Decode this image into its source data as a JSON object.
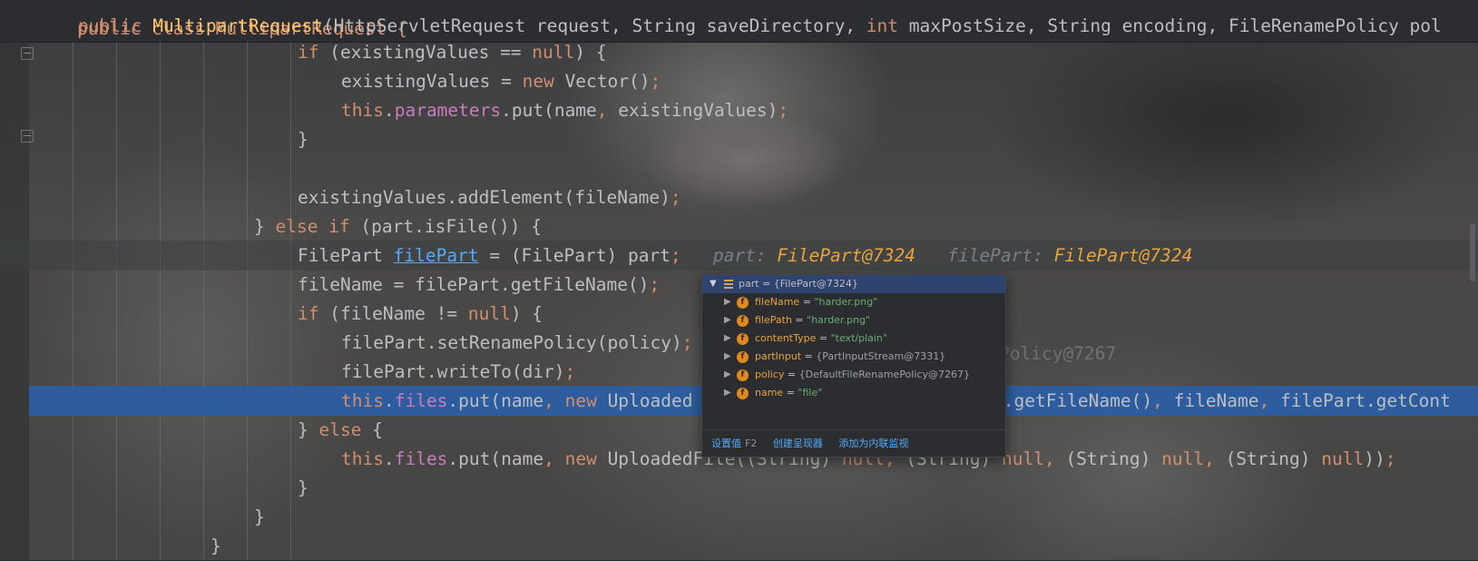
{
  "code": {
    "line0": "public class MultipartRequest {",
    "line1_kw": "public",
    "line1_name": "MultipartRequest",
    "line1_params_a": "(HttpServletRequest request, String saveDirectory, ",
    "line1_int": "int",
    "line1_params_b": " maxPostSize, String encoding, FileRenamePolicy pol",
    "l2_kw": "if",
    "l2_a": " (existingValues == ",
    "l2_null": "null",
    "l2_b": ") {",
    "l3_a": "existingValues = ",
    "l3_new": "new",
    "l3_b": " Vector()",
    "l3_semi": ";",
    "l4_this": "this",
    "l4_dot": ".",
    "l4_field": "parameters",
    "l4_b": ".put(name",
    "l4_comma": ",",
    "l4_c": " existingValues)",
    "l4_semi": ";",
    "l5": "}",
    "l7_a": "existingValues.addElement(fileName)",
    "l7_semi": ";",
    "l8_a": "} ",
    "l8_else": "else if",
    "l8_b": " (part.isFile()) {",
    "l9_a": "FilePart ",
    "l9_var": "filePart",
    "l9_b": " = (FilePart) part",
    "l9_semi": ";",
    "l9_hint1_k": "part: ",
    "l9_hint1_v": "FilePart@7324",
    "l9_hint2_k": "filePart: ",
    "l9_hint2_v": "FilePart@7324",
    "l10_a": "fileName = filePart.getFileName()",
    "l10_semi": ";",
    "l11_kw": "if",
    "l11_a": " (fileName != ",
    "l11_null": "null",
    "l11_b": ") {",
    "l12_a": "filePart.setRenamePolicy(policy)",
    "l12_semi": ";",
    "l12_ghost": "Policy@7267",
    "l13_a": "filePart.writeTo(dir)",
    "l13_semi": ";",
    "l14_this": "this",
    "l14_dot": ".",
    "l14_field": "files",
    "l14_a": ".put(name",
    "l14_comma": ",",
    "l14_new": "new",
    "l14_b": " Uploaded",
    "l14_tail_a": "t.getFileName()",
    "l14_tail_c1": ",",
    "l14_tail_b": " fileName",
    "l14_tail_c2": ",",
    "l14_tail_c": " filePart.getCont",
    "l15_a": "} ",
    "l15_else": "else",
    "l15_b": " {",
    "l16_this": "this",
    "l16_dot": ".",
    "l16_field": "files",
    "l16_a": ".put(name",
    "l16_comma": ",",
    "l16_new": "new",
    "l16_b": " UploadedFile((String) ",
    "l16_null1": "null",
    "l16_c1": ",",
    "l16_c": " (String) ",
    "l16_null2": "null",
    "l16_c2": ",",
    "l16_d": " (String) ",
    "l16_null3": "null",
    "l16_c3": ",",
    "l16_e": " (String) ",
    "l16_null4": "null",
    "l16_f": "))",
    "l16_semi": ";",
    "l17": "}",
    "l18": "}",
    "l19": "}"
  },
  "debug_popup": {
    "root_label": "part = {FilePart@7324}",
    "fields": [
      {
        "name": "fileName",
        "eq": " = ",
        "value": "\"harder.png\"",
        "kind": "string"
      },
      {
        "name": "filePath",
        "eq": " = ",
        "value": "\"harder.png\"",
        "kind": "string"
      },
      {
        "name": "contentType",
        "eq": " = ",
        "value": "\"text/plain\"",
        "kind": "string"
      },
      {
        "name": "partInput",
        "eq": " = ",
        "value": "{PartInputStream@7331}",
        "kind": "ref"
      },
      {
        "name": "policy",
        "eq": " = ",
        "value": "{DefaultFileRenamePolicy@7267}",
        "kind": "ref"
      },
      {
        "name": "name",
        "eq": " = ",
        "value": "\"file\"",
        "kind": "string"
      }
    ],
    "field_icon": "f",
    "actions": {
      "set_value": "设置值",
      "set_value_key": "F2",
      "create_renderer": "创建呈现器",
      "add_inline_watch": "添加为内联监视"
    }
  },
  "colors": {
    "keyword": "#cf8e6d",
    "method": "#ffc66d",
    "field": "#c77dbb",
    "exec_line": "#2e5d9f",
    "hint_value": "#e8a33d"
  }
}
